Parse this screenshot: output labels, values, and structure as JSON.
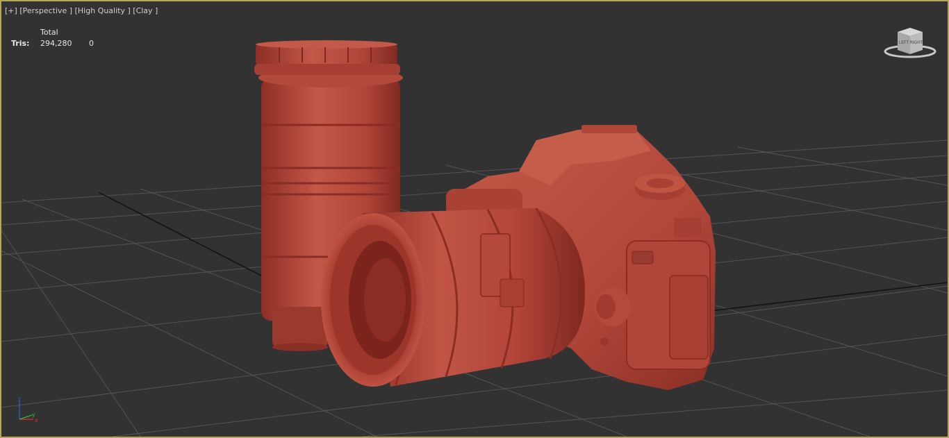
{
  "viewport": {
    "label_plus": "[+]",
    "label_view": "[Perspective ]",
    "label_quality": "[High Quality ]",
    "label_shading": "[Clay ]"
  },
  "stats": {
    "header": "Total",
    "tris_label": "Tris:",
    "tris_total": "294,280",
    "tris_selected": "0"
  },
  "viewcube": {
    "face_left": "LEFT",
    "face_right": "RIGHT"
  },
  "axis": {
    "x_label": "x",
    "y_label": "y",
    "z_label": "z"
  },
  "colors": {
    "viewport_border": "#b8a45a",
    "background": "#323232",
    "grid": "#555555",
    "clay": "#b9463a",
    "axis_x": "#e03030",
    "axis_y": "#30c030",
    "axis_z": "#3060e0"
  }
}
